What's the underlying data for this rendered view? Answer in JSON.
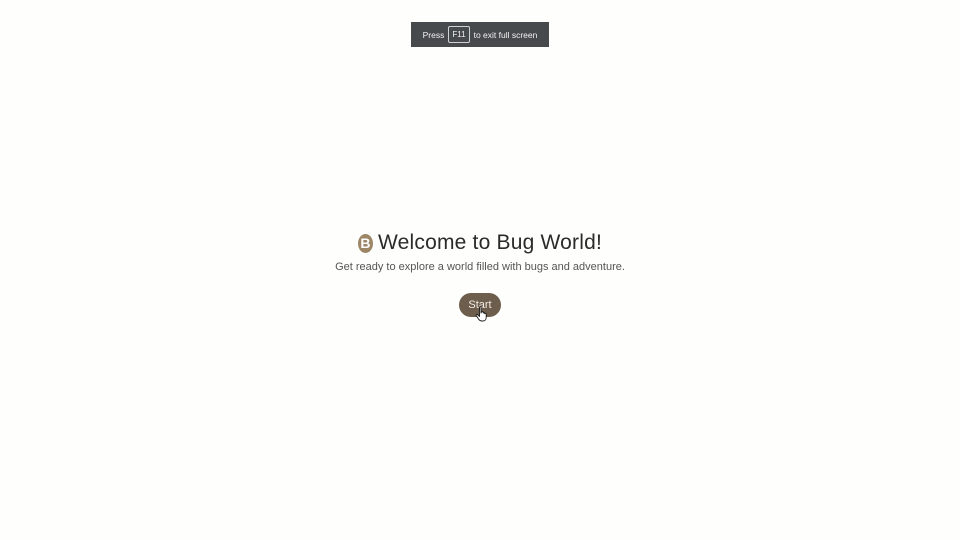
{
  "fullscreen_notice": {
    "prefix": "Press",
    "key": "F11",
    "suffix": "to exit full screen"
  },
  "welcome": {
    "logo_letter": "B",
    "title": "Welcome to Bug World!",
    "subtitle": "Get ready to explore a world filled with bugs and adventure.",
    "start_label": "Start"
  },
  "colors": {
    "accent": "#6c5d4d",
    "logo": "#9c8666",
    "background": "#fefefc"
  }
}
